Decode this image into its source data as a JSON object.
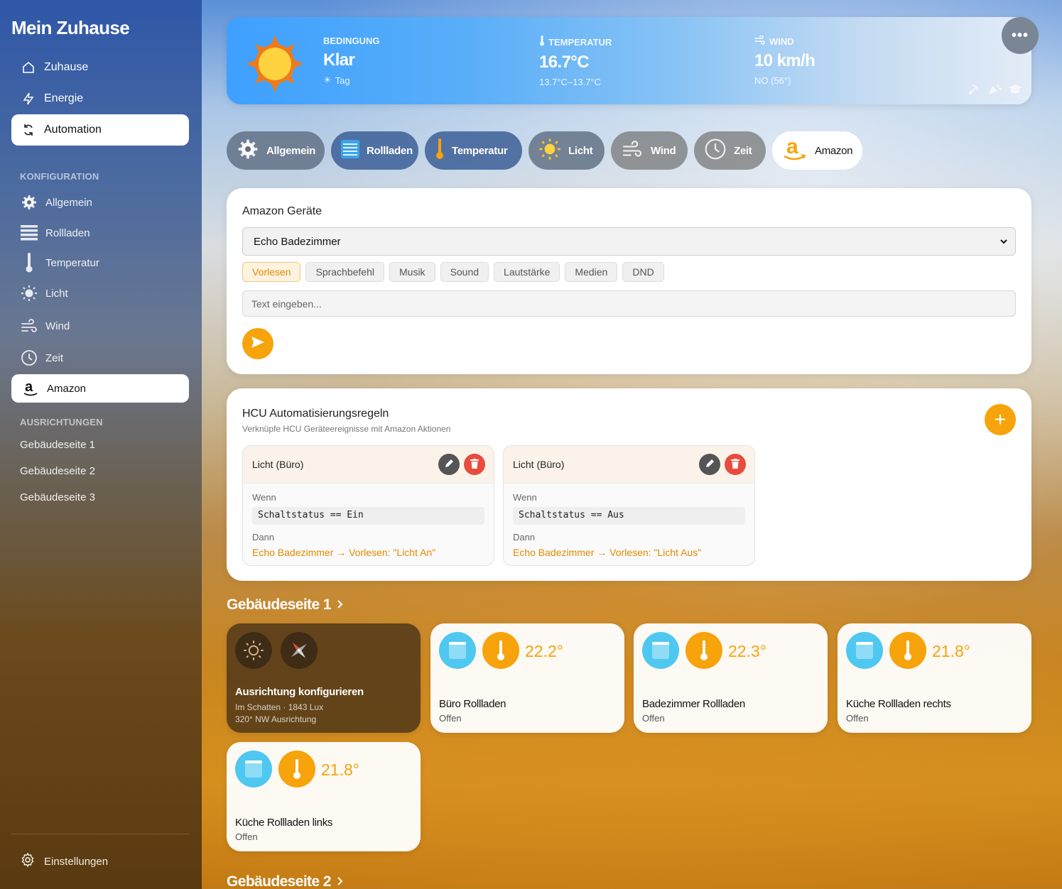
{
  "sidebar": {
    "title": "Mein Zuhause",
    "nav": [
      {
        "label": "Zuhause",
        "icon": "home-icon"
      },
      {
        "label": "Energie",
        "icon": "bolt-icon"
      },
      {
        "label": "Automation",
        "icon": "sync-icon",
        "active": true
      }
    ],
    "config_label": "KONFIGURATION",
    "config": [
      {
        "label": "Allgemein",
        "icon": "gear-icon"
      },
      {
        "label": "Rollladen",
        "icon": "blinds-icon"
      },
      {
        "label": "Temperatur",
        "icon": "thermometer-icon"
      },
      {
        "label": "Licht",
        "icon": "sun-icon"
      },
      {
        "label": "Wind",
        "icon": "wind-icon"
      },
      {
        "label": "Zeit",
        "icon": "clock-icon"
      },
      {
        "label": "Amazon",
        "icon": "amazon-icon",
        "active": true
      }
    ],
    "orient_label": "AUSRICHTUNGEN",
    "orient": [
      "Gebäudeseite 1",
      "Gebäudeseite 2",
      "Gebäudeseite 3"
    ],
    "settings": "Einstellungen"
  },
  "weather": {
    "condition_label": "BEDINGUNG",
    "condition": "Klar",
    "daytime": "Tag",
    "temp_label": "TEMPERATUR",
    "temp": "16.7°C",
    "temp_range": "13.7°C–13.7°C",
    "wind_label": "WIND",
    "wind": "10 km/h",
    "wind_dir": "NO (56°)",
    "more": "•••"
  },
  "tabs": [
    {
      "label": "Allgemein",
      "icon": "gear-icon",
      "color": "#5f6e82"
    },
    {
      "label": "Rollladen",
      "icon": "blinds-icon",
      "color": "#3c5f96"
    },
    {
      "label": "Temperatur",
      "icon": "thermometer-icon",
      "color": "#3c5f96"
    },
    {
      "label": "Licht",
      "icon": "sun-icon",
      "color": "#5f6e82"
    },
    {
      "label": "Wind",
      "icon": "wind-icon",
      "color": "#787878"
    },
    {
      "label": "Zeit",
      "icon": "clock-icon",
      "color": "#787878"
    },
    {
      "label": "Amazon",
      "icon": "amazon-icon",
      "active": true
    }
  ],
  "amazon": {
    "title": "Amazon Geräte",
    "device": "Echo Badezimmer",
    "actions": [
      "Vorlesen",
      "Sprachbefehl",
      "Musik",
      "Sound",
      "Lautstärke",
      "Medien",
      "DND"
    ],
    "active_action": "Vorlesen",
    "input_placeholder": "Text eingeben..."
  },
  "hcu": {
    "title": "HCU Automatisierungsregeln",
    "subtitle": "Verknüpfe HCU Geräteereignisse mit Amazon Aktionen",
    "rules": [
      {
        "title": "Licht (Büro)",
        "when_label": "Wenn",
        "condition": "Schaltstatus == Ein",
        "then_label": "Dann",
        "action": "Echo Badezimmer → Vorlesen: \"Licht An\""
      },
      {
        "title": "Licht (Büro)",
        "when_label": "Wenn",
        "condition": "Schaltstatus == Aus",
        "then_label": "Dann",
        "action": "Echo Badezimmer → Vorlesen: \"Licht Aus\""
      }
    ]
  },
  "groups": [
    {
      "title": "Gebäudeseite 1",
      "orient_tile": {
        "name": "Ausrichtung konfigurieren",
        "line1": "Im Schatten · 1843 Lux",
        "line2": "320° NW Ausrichtung"
      },
      "tiles": [
        {
          "name": "Büro Rollladen",
          "status": "Offen",
          "temp": "22.2°"
        },
        {
          "name": "Badezimmer Rollladen",
          "status": "Offen",
          "temp": "22.3°"
        },
        {
          "name": "Küche Rollladen rechts",
          "status": "Offen",
          "temp": "21.8°"
        },
        {
          "name": "Küche Rollladen links",
          "status": "Offen",
          "temp": "21.8°"
        }
      ]
    },
    {
      "title": "Gebäudeseite 2"
    }
  ],
  "colors": {
    "accent": "#f7a30b",
    "cyan": "#4ec8f0",
    "delete": "#e94b3c"
  }
}
